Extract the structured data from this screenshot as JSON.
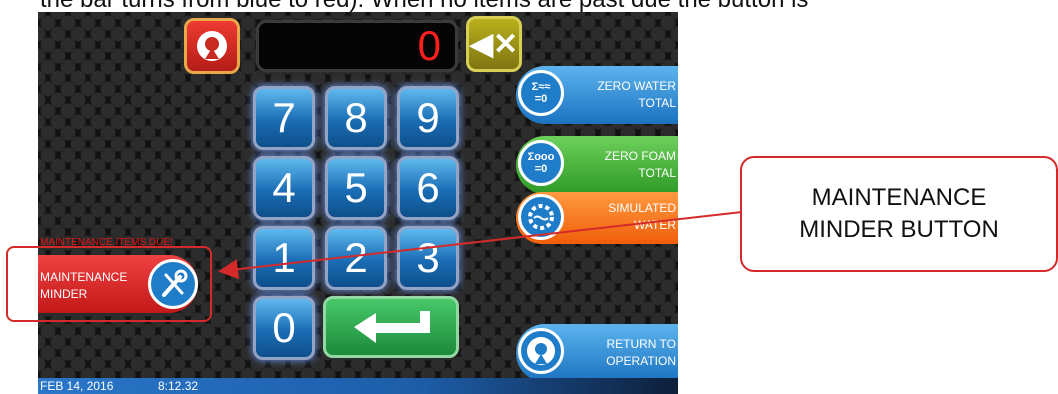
{
  "caption": "the bar turns from blue to red). When no items are past due the button is",
  "display": {
    "value": "0"
  },
  "keypad": {
    "keys": [
      "7",
      "8",
      "9",
      "4",
      "5",
      "6",
      "1",
      "2",
      "3",
      "0"
    ]
  },
  "side_buttons": {
    "zero_water": {
      "line1": "ZERO WATER",
      "line2": "TOTAL",
      "icon_text1": "Σ≈≈",
      "icon_text2": "=0"
    },
    "zero_foam": {
      "line1": "ZERO FOAM",
      "line2": "TOTAL",
      "icon_text1": "Σooo",
      "icon_text2": "=0"
    },
    "simulated_water": {
      "line1": "SIMULATED",
      "line2": "WATER"
    },
    "return_to_operation": {
      "line1": "RETURN TO",
      "line2": "OPERATION"
    }
  },
  "maintenance": {
    "due_text": "MAINTENANCE ITEMS DUE!",
    "line1": "MAINTENANCE",
    "line2": "MINDER"
  },
  "status_bar": {
    "date": "FEB 14, 2016",
    "time": "8:12.32"
  },
  "callout": {
    "line1": "MAINTENANCE",
    "line2": "MINDER BUTTON"
  },
  "colors": {
    "accent_red": "#d42a2a",
    "display_red": "#ff1f1f",
    "key_blue": "#1a6cb4"
  },
  "icons": {
    "reset": "reset-icon",
    "backspace": "backspace-icon",
    "enter": "enter-arrow-icon",
    "wrench": "wrench-screwdriver-icon"
  }
}
